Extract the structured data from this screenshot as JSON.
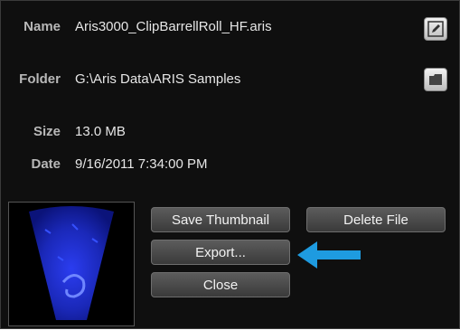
{
  "details": {
    "name_label": "Name",
    "name_value": "Aris3000_ClipBarrellRoll_HF.aris",
    "folder_label": "Folder",
    "folder_value": "G:\\Aris Data\\ARIS Samples",
    "size_label": "Size",
    "size_value": "13.0 MB",
    "date_label": "Date",
    "date_value": "9/16/2011 7:34:00 PM"
  },
  "buttons": {
    "save_thumbnail": "Save Thumbnail",
    "delete_file": "Delete File",
    "export": "Export...",
    "close": "Close"
  },
  "icons": {
    "edit": "edit-pencil-icon",
    "folder": "folder-icon",
    "pointer": "arrow-pointer-icon"
  },
  "colors": {
    "panel_bg": "#0f0f0f",
    "arrow": "#1e9be0",
    "sonar_blue": "#1a2fd0"
  }
}
